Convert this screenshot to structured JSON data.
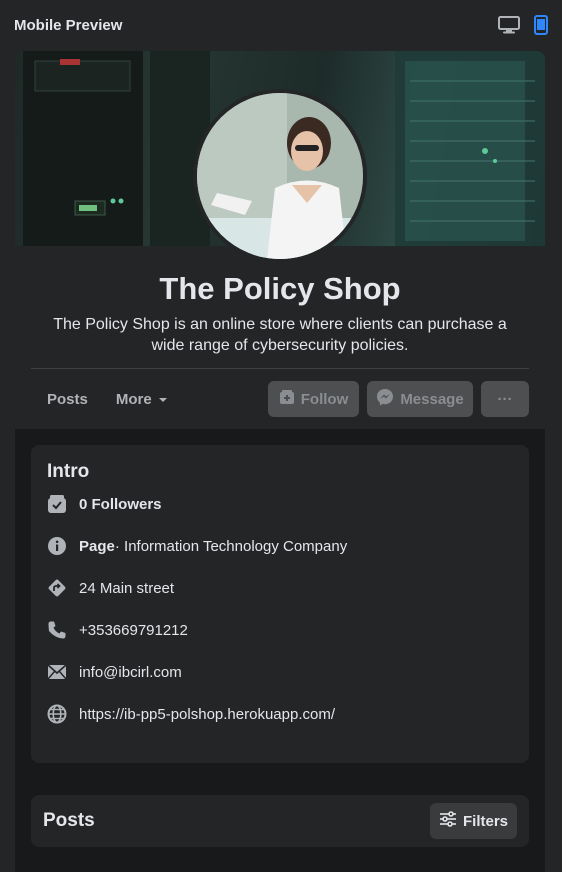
{
  "topbar": {
    "title": "Mobile Preview",
    "icons": [
      "desktop-icon",
      "mobile-icon"
    ],
    "active_color": "#2d88ff"
  },
  "profile": {
    "name": "The Policy Shop",
    "description": "The Policy Shop is an online store where clients can purchase a wide range of cybersecurity policies."
  },
  "tabs": [
    {
      "label": "Posts"
    },
    {
      "label": "More"
    }
  ],
  "buttons": {
    "follow": "Follow",
    "message": "Message",
    "more": "···"
  },
  "intro": {
    "title": "Intro",
    "followers_count": "0",
    "followers_label": "Followers",
    "page_label": "Page",
    "category": " · Information Technology Company",
    "address": "24 Main street",
    "phone": "+353669791212",
    "email": "info@ibcirl.com",
    "website": "https://ib-pp5-polshop.herokuapp.com/"
  },
  "posts": {
    "title": "Posts",
    "filters_label": "Filters"
  }
}
